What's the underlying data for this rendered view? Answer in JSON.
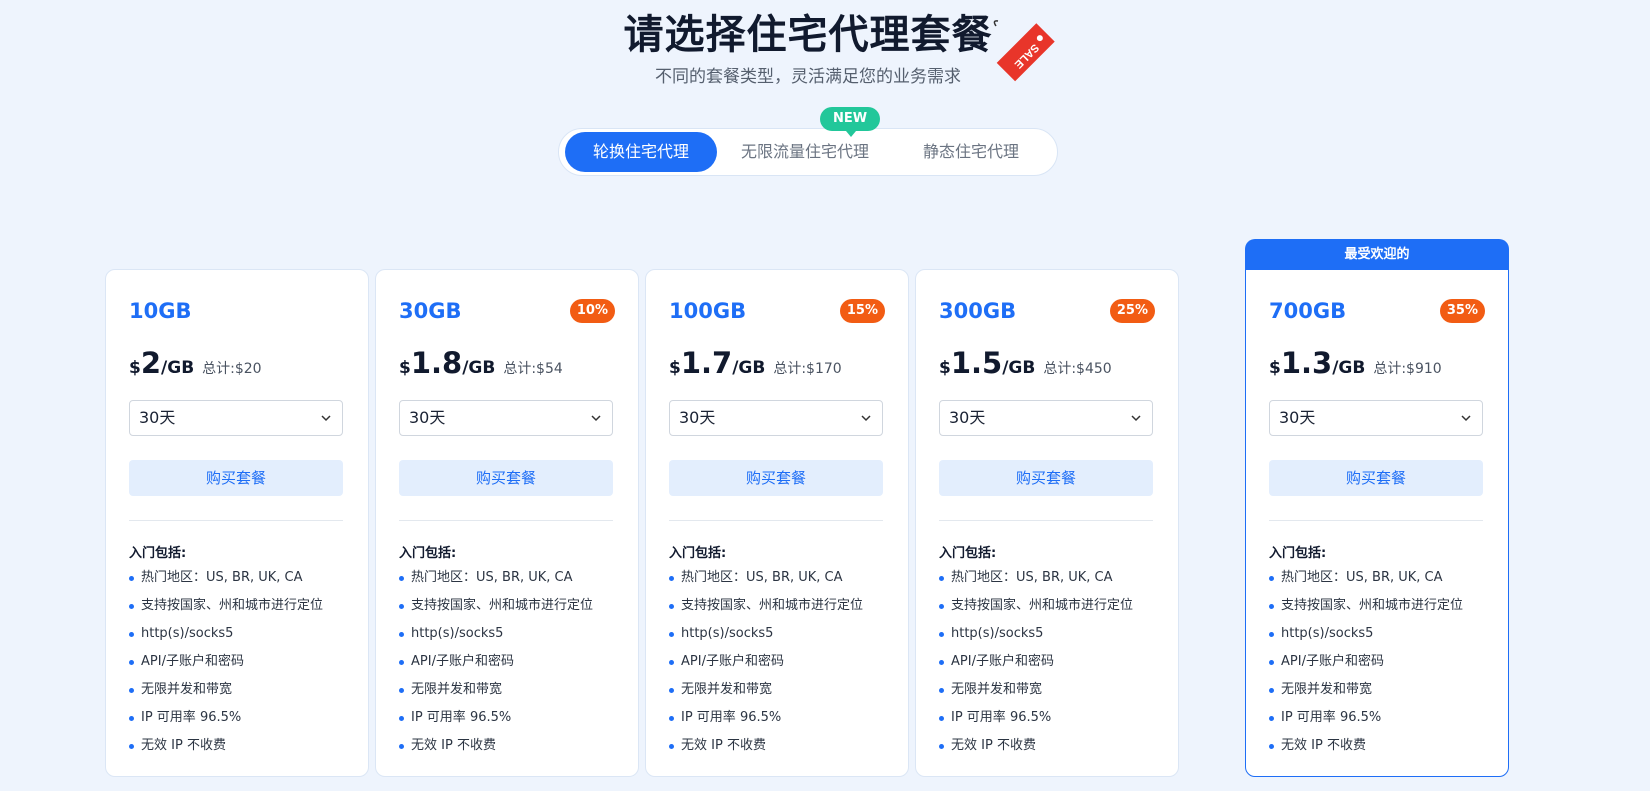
{
  "header": {
    "title": "请选择住宅代理套餐",
    "subtitle": "不同的套餐类型，灵活满足您的业务需求",
    "sale_tag": "SALE"
  },
  "tabs": [
    {
      "label": "轮换住宅代理",
      "active": true
    },
    {
      "label": "无限流量住宅代理",
      "active": false
    },
    {
      "label": "静态住宅代理",
      "active": false
    }
  ],
  "new_badge": "NEW",
  "popular_label": "最受欢迎的",
  "cards": [
    {
      "size": "10GB",
      "discount": "",
      "currency": "$",
      "price": "2",
      "unit": "/GB",
      "total": "总计:$20",
      "duration": "30天",
      "buy": "购买套餐"
    },
    {
      "size": "30GB",
      "discount": "10%",
      "currency": "$",
      "price": "1.8",
      "unit": "/GB",
      "total": "总计:$54",
      "duration": "30天",
      "buy": "购买套餐"
    },
    {
      "size": "100GB",
      "discount": "15%",
      "currency": "$",
      "price": "1.7",
      "unit": "/GB",
      "total": "总计:$170",
      "duration": "30天",
      "buy": "购买套餐"
    },
    {
      "size": "300GB",
      "discount": "25%",
      "currency": "$",
      "price": "1.5",
      "unit": "/GB",
      "total": "总计:$450",
      "duration": "30天",
      "buy": "购买套餐"
    },
    {
      "size": "700GB",
      "discount": "35%",
      "currency": "$",
      "price": "1.3",
      "unit": "/GB",
      "total": "总计:$910",
      "duration": "30天",
      "buy": "购买套餐"
    }
  ],
  "features_title": "入门包括:",
  "features": [
    "热门地区：US, BR, UK, CA",
    "支持按国家、州和城市进行定位",
    "http(s)/socks5",
    "API/子账户和密码",
    "无限并发和带宽",
    "IP 可用率 96.5%",
    "无效 IP 不收费"
  ],
  "colors": {
    "accent": "#1e6ef6",
    "discount": "#f25c13",
    "new_badge": "#22c79a",
    "background": "#eef4fd"
  }
}
